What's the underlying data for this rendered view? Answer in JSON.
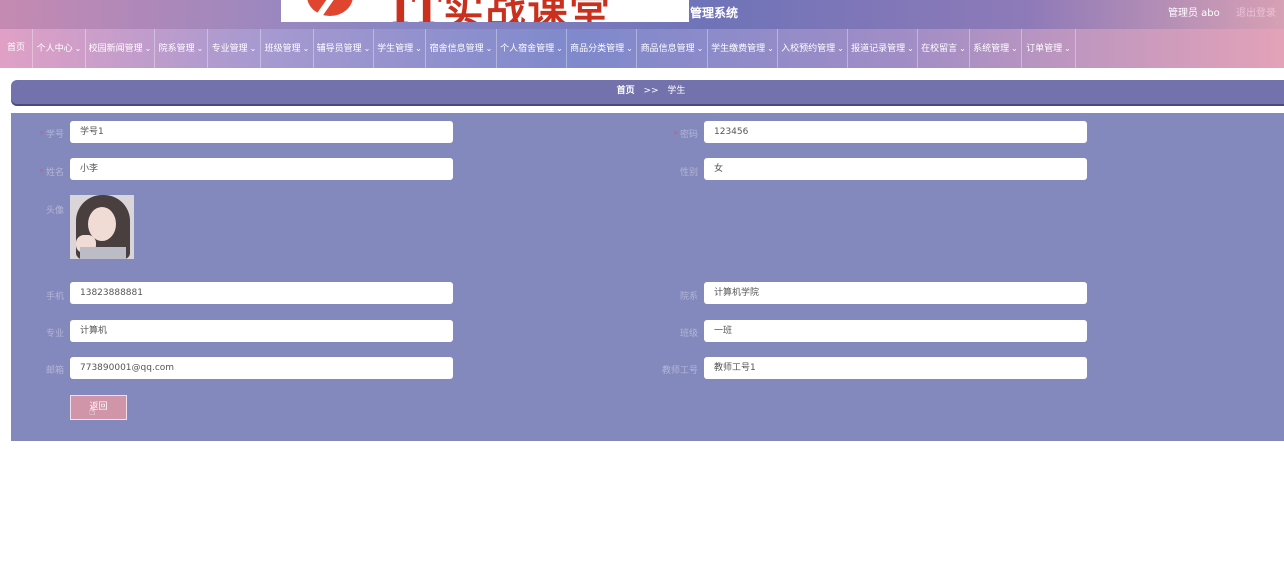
{
  "header": {
    "watermark_text": "IT实战课堂",
    "system_title": "管理系统",
    "user_info": "管理员 abo",
    "logout": "退出登录"
  },
  "nav": {
    "items": [
      {
        "label": "首页",
        "chev": ""
      },
      {
        "label": "个人中心",
        "chev": "⌄"
      },
      {
        "label": "校园新闻管理",
        "chev": "⌄"
      },
      {
        "label": "院系管理",
        "chev": "⌄"
      },
      {
        "label": "专业管理",
        "chev": "⌄"
      },
      {
        "label": "班级管理",
        "chev": "⌄"
      },
      {
        "label": "辅导员管理",
        "chev": "⌄"
      },
      {
        "label": "学生管理",
        "chev": "⌄"
      },
      {
        "label": "宿舍信息管理",
        "chev": "⌄"
      },
      {
        "label": "个人宿舍管理",
        "chev": "⌄"
      },
      {
        "label": "商品分类管理",
        "chev": "⌄"
      },
      {
        "label": "商品信息管理",
        "chev": "⌄"
      },
      {
        "label": "学生缴费管理",
        "chev": "⌄"
      },
      {
        "label": "入校预约管理",
        "chev": "⌄"
      },
      {
        "label": "报道记录管理",
        "chev": "⌄"
      },
      {
        "label": "在校留言",
        "chev": "⌄"
      },
      {
        "label": "系统管理",
        "chev": "⌄"
      },
      {
        "label": "订单管理",
        "chev": "⌄"
      }
    ]
  },
  "breadcrumb": {
    "home": "首页",
    "separator": ">>",
    "current": "学生"
  },
  "form": {
    "required_mark": "*",
    "student_id": {
      "label": "学号",
      "value": "学号1"
    },
    "password": {
      "label": "密码",
      "value": "123456"
    },
    "name": {
      "label": "姓名",
      "value": "小李"
    },
    "gender": {
      "label": "性别",
      "value": "女"
    },
    "avatar": {
      "label": "头像"
    },
    "phone": {
      "label": "手机",
      "value": "13823888881"
    },
    "department": {
      "label": "院系",
      "value": "计算机学院"
    },
    "major": {
      "label": "专业",
      "value": "计算机"
    },
    "class": {
      "label": "班级",
      "value": "一班"
    },
    "email": {
      "label": "邮箱",
      "value": "773890001@qq.com"
    },
    "teacher_id": {
      "label": "教师工号",
      "value": "教师工号1"
    },
    "return_button": "返回"
  },
  "colors": {
    "panel": "#8389bc",
    "breadcrumb": "#7472ad",
    "return_button": "#d095a8"
  }
}
